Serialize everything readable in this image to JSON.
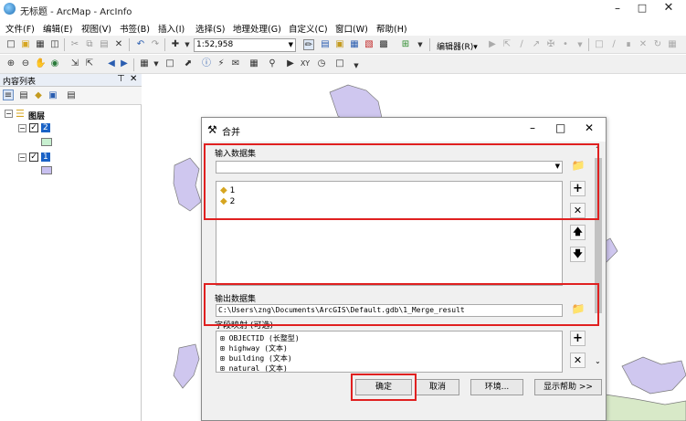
{
  "window": {
    "title": "无标题 - ArcMap - ArcInfo"
  },
  "menu": [
    "文件(F)",
    "编辑(E)",
    "视图(V)",
    "书签(B)",
    "插入(I)",
    "选择(S)",
    "地理处理(G)",
    "自定义(C)",
    "窗口(W)",
    "帮助(H)"
  ],
  "toolbar": {
    "scale": "1:52,958",
    "editor_label": "编辑器(R)▾"
  },
  "toc": {
    "title": "内容列表",
    "root_label": "图层",
    "layers": [
      {
        "name": "2",
        "symbol_color": "#c8f0d0"
      },
      {
        "name": "1",
        "symbol_color": "#c8c0f0"
      }
    ]
  },
  "dialog": {
    "title": "合并",
    "input_label": "输入数据集",
    "inputs": [
      "1",
      "2"
    ],
    "output_label": "输出数据集",
    "output_path": "C:\\Users\\zng\\Documents\\ArcGIS\\Default.gdb\\1_Merge_result",
    "field_map_label": "字段映射 (可选)",
    "fields": [
      "OBJECTID (长整型)",
      "highway (文本)",
      "building (文本)",
      "natural (文本)"
    ],
    "buttons": {
      "ok": "确定",
      "cancel": "取消",
      "env": "环境...",
      "help": "显示帮助 >>"
    }
  },
  "colors": {
    "highlight": "#e02020",
    "polygon_fill": "#cfc7ef",
    "polygon_fill_green": "#d8e9c8",
    "polygon_stroke": "#7a7a7a"
  }
}
